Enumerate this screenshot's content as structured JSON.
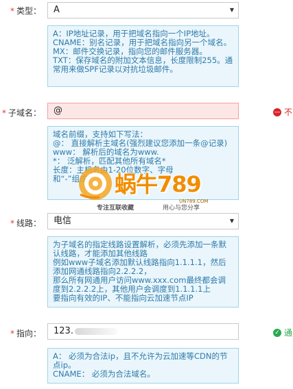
{
  "type_row": {
    "label": "类型：",
    "required": "*",
    "value": "A",
    "tip_lines": [
      "A：IP地址记录，用于把域名指向一个IP地址。",
      "CNAME：别名记录，用于把域名指向另一个域名。",
      "MX：邮件交换记录，指向您的邮件服务器。",
      "TXT：保存域名的附加文本信息，长度限制255。通常用来做SPF记录以对抗垃圾邮件。"
    ]
  },
  "subdomain_row": {
    "label": "子域名：",
    "required": "*",
    "value": "@",
    "status_text": "不",
    "tip_lines": [
      "域名前缀，支持如下写法：",
      "@： 直接解析主域名(强烈建议您添加一条@记录)",
      "www： 解析后的域名为www.",
      "*： 泛解析，匹配其他所有域名*",
      "长度：主机名由1-20位数字、字母",
      "和“-”组成"
    ]
  },
  "line_row": {
    "label": "线路：",
    "required": "*",
    "value": "电信",
    "tip_lines": [
      "为子域名的指定线路设置解析，必须先添加一条默认线路，才能添加其他线路",
      "例如www子域名添加默认线路指向1.1.1.1，然后添加网通线路指向2.2.2.2，",
      "那么所有网通用户访问www.xxx.com最终都会调度到2.2.2.2上，其他用户会调度到1.1.1.1上",
      "要指向有效的IP、不能指向云加速节点IP"
    ]
  },
  "target_row": {
    "label": "指向：",
    "required": "*",
    "value": "123.",
    "status_text": "通",
    "tip_lines": [
      "A： 必须为合法ip，且不允许为云加速等CDN的节点ip。",
      "CNAME： 必须为合法域名。"
    ]
  },
  "watermark": {
    "brand": "蜗牛789",
    "domain": "UN789.COM",
    "slogan_left": "专注互联收藏",
    "slogan_right": "用心与您分享"
  },
  "colors": {
    "required": "#e4393c",
    "tip_border": "#9fd3e6",
    "tip_bg": "#eaf6fc",
    "tip_text": "#2e7aa8",
    "error": "#d9242a",
    "success": "#2aa952",
    "watermark": "#f18d00"
  },
  "icons": {
    "select_arrow": "caret-down-icon",
    "error": "error-circle-icon",
    "success": "check-circle-icon"
  }
}
